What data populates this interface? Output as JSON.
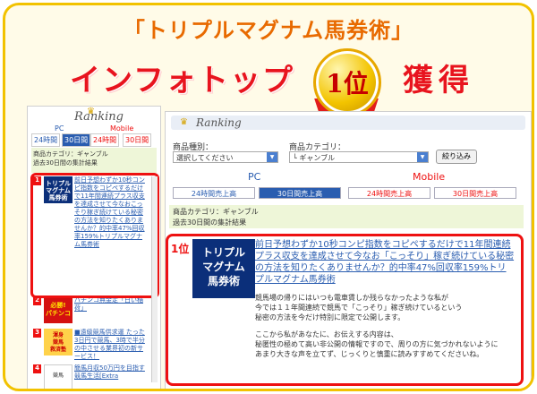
{
  "banner": {
    "title": "「トリプルマグナム馬券術」",
    "headline": "インフォトップ",
    "badge": "1位",
    "headline_suffix": "獲得"
  },
  "left_panel": {
    "logo": "Ranking",
    "pc_label": "PC",
    "mobile_label": "Mobile",
    "tabs": [
      "24時間",
      "30日間",
      "24時間",
      "30日間"
    ],
    "category_line1": "商品カテゴリ：ギャンブル",
    "category_line2": "過去30日間の集計結果",
    "items": [
      {
        "rank": "1",
        "thumb": "トリプル\nマグナム\n馬券術",
        "text": "前日予想わずか10秒コンピ指数をコピペするだけで11年間連続プラス収支を達成させて今なおこっそり稼ぎ続けている秘密の方法を知りたくありませんか？的中率47%回収率159%トリプルマグナム馬券術"
      },
      {
        "rank": "2",
        "thumb": "必勝!\nパチンコ",
        "text": "パチンコ無金定「白い稲荷」"
      },
      {
        "rank": "3",
        "thumb": "渾身\n競馬\n救済塾",
        "text": "■遠級競馬供求運 たった3日円で競馬、3時で半分の中させる業界初の新サービス！"
      },
      {
        "rank": "4",
        "thumb": "競馬",
        "text": "簡馬月収50万円を目指す競馬生活[Extra"
      }
    ]
  },
  "right_panel": {
    "logo": "Ranking",
    "product_type_label": "商品種別：",
    "product_type_value": "選択してください",
    "category_label": "商品カテゴリ：",
    "category_value": "└ ギャンブル",
    "narrow_button": "絞り込み",
    "pc_label": "PC",
    "mobile_label": "Mobile",
    "tabs": [
      "24時間売上高",
      "30日間売上高",
      "24時間売上高",
      "30日間売上高"
    ],
    "category_line1": "商品カテゴリ：ギャンブル",
    "category_line2": "過去30日間の集計結果",
    "top_item": {
      "rank": "1位",
      "thumb_lines": [
        "トリプル",
        "マグナム",
        "馬券術"
      ],
      "title": "前日予想わずか10秒コンピ指数をコピペするだけで11年間連続プラス収支を達成させて今なお「こっそり」稼ぎ続けている秘密の方法を知りたくありませんか？的中率47%回収率159%トリプルマグナム馬券術",
      "description": [
        "競馬場の帰りにはいつも電車賃しか残らなかったような私が",
        "今では１１年間連続で競馬で「こっそり」稼ぎ続けているという",
        "秘密の方法を今だけ特別に限定で公開します。",
        "",
        "ここから私があなたに、お伝えする内容は、",
        "秘匿性の極めて高い非公開の情報ですので、周りの方に気づかれないように",
        "あまり大きな声を立てず、じっくりと慎重に読みすすめてくださいね。"
      ]
    }
  },
  "colors": {
    "accent_red": "#e8141e",
    "gold": "#f2c200",
    "link_blue": "#2a5db0"
  }
}
